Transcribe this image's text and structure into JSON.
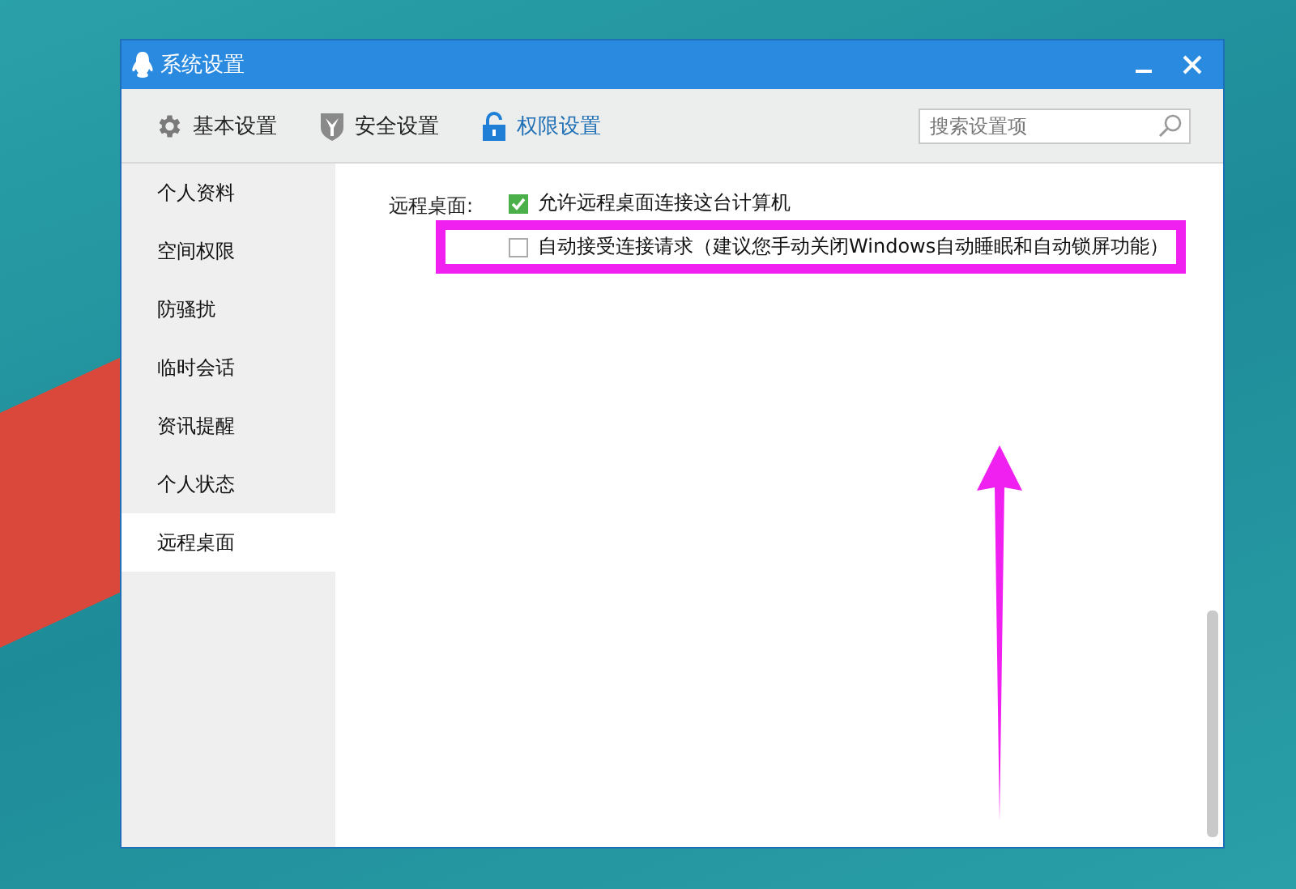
{
  "window": {
    "title": "系统设置"
  },
  "tabs": [
    {
      "label": "基本设置",
      "kind": "gear",
      "selected": false
    },
    {
      "label": "安全设置",
      "kind": "shield",
      "selected": false
    },
    {
      "label": "权限设置",
      "kind": "lock",
      "selected": true
    }
  ],
  "search": {
    "placeholder": "搜索设置项"
  },
  "sidebar": {
    "items": [
      {
        "label": "个人资料",
        "selected": false
      },
      {
        "label": "空间权限",
        "selected": false
      },
      {
        "label": "防骚扰",
        "selected": false
      },
      {
        "label": "临时会话",
        "selected": false
      },
      {
        "label": "资讯提醒",
        "selected": false
      },
      {
        "label": "个人状态",
        "selected": false
      },
      {
        "label": "远程桌面",
        "selected": true
      }
    ]
  },
  "section": {
    "label": "远程桌面:",
    "options": [
      {
        "label": "允许远程桌面连接这台计算机",
        "checked": true,
        "highlighted": false
      },
      {
        "label": "自动接受连接请求（建议您手动关闭Windows自动睡眠和自动锁屏功能）",
        "checked": false,
        "highlighted": true
      }
    ]
  }
}
